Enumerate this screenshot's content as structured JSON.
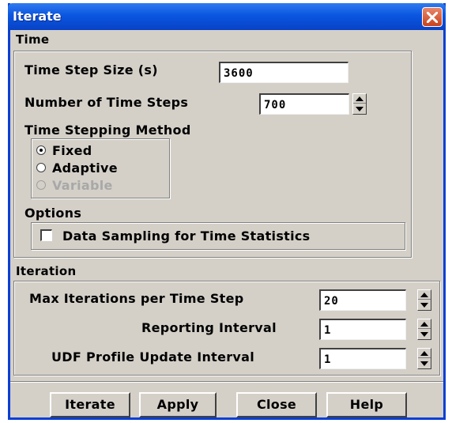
{
  "window": {
    "title": "Iterate",
    "close_icon": "close-x-icon"
  },
  "time": {
    "section_label": "Time",
    "time_step_size_label": "Time Step Size (s)",
    "time_step_size_value": "3600",
    "num_time_steps_label": "Number of Time Steps",
    "num_time_steps_value": "700",
    "stepping_method_label": "Time Stepping Method",
    "methods": [
      {
        "label": "Fixed",
        "selected": true,
        "enabled": true
      },
      {
        "label": "Adaptive",
        "selected": false,
        "enabled": true
      },
      {
        "label": "Variable",
        "selected": false,
        "enabled": false
      }
    ],
    "options_label": "Options",
    "data_sampling_label": "Data Sampling for Time Statistics",
    "data_sampling_checked": false
  },
  "iteration": {
    "section_label": "Iteration",
    "max_iter_label": "Max Iterations per Time Step",
    "max_iter_value": "20",
    "reporting_label": "Reporting Interval",
    "reporting_value": "1",
    "udf_label": "UDF Profile Update Interval",
    "udf_value": "1"
  },
  "buttons": {
    "iterate": "Iterate",
    "apply": "Apply",
    "close": "Close",
    "help": "Help"
  }
}
